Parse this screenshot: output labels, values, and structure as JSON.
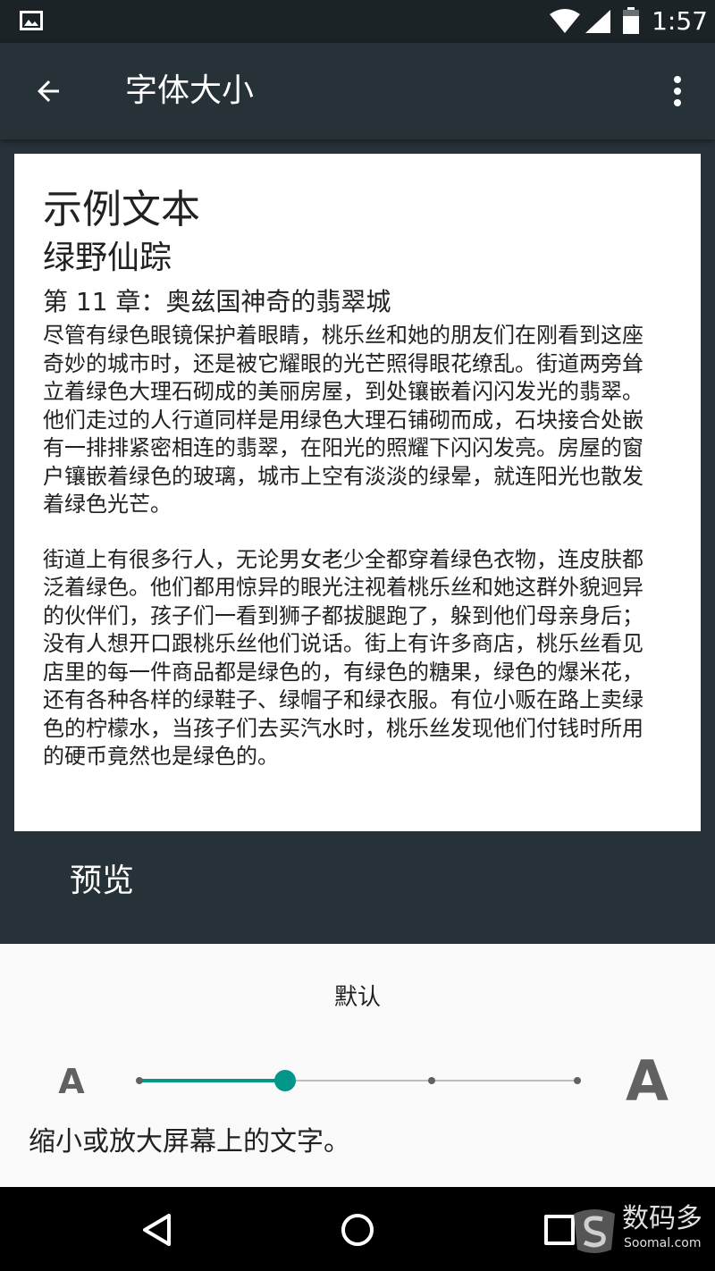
{
  "status_bar": {
    "time": "1:57"
  },
  "app_bar": {
    "title": "字体大小"
  },
  "preview": {
    "heading": "示例文本",
    "book_title": "绿野仙踪",
    "chapter_title": "第 11 章：奥兹国神奇的翡翠城",
    "paragraphs": [
      "尽管有绿色眼镜保护着眼睛，桃乐丝和她的朋友们在刚看到这座奇妙的城市时，还是被它耀眼的光芒照得眼花缭乱。街道两旁耸立着绿色大理石砌成的美丽房屋，到处镶嵌着闪闪发光的翡翠。他们走过的人行道同样是用绿色大理石铺砌而成，石块接合处嵌有一排排紧密相连的翡翠，在阳光的照耀下闪闪发亮。房屋的窗户镶嵌着绿色的玻璃，城市上空有淡淡的绿晕，就连阳光也散发着绿色光芒。",
      "街道上有很多行人，无论男女老少全都穿着绿色衣物，连皮肤都泛着绿色。他们都用惊异的眼光注视着桃乐丝和她这群外貌迥异的伙伴们，孩子们一看到狮子都拔腿跑了，躲到他们母亲身后；没有人想开口跟桃乐丝他们说话。街上有许多商店，桃乐丝看见店里的每一件商品都是绿色的，有绿色的糖果，绿色的爆米花，还有各种各样的绿鞋子、绿帽子和绿衣服。有位小贩在路上卖绿色的柠檬水，当孩子们去买汽水时，桃乐丝发现他们付钱时所用的硬币竟然也是绿色的。"
    ],
    "label": "预览"
  },
  "font_size": {
    "level_name": "默认",
    "small_label": "A",
    "large_label": "A",
    "steps": 4,
    "selected_index": 1,
    "accent_color": "#009688",
    "description": "缩小或放大屏幕上的文字。"
  },
  "watermark": {
    "name": "数码多",
    "domain": "Soomal.com"
  },
  "icons": {
    "status": [
      "gallery-icon",
      "wifi-icon",
      "signal-icon",
      "battery-icon"
    ],
    "app_bar": [
      "arrow-back-icon",
      "more-vert-icon"
    ],
    "navigation": [
      "back-triangle-icon",
      "home-circle-icon",
      "recents-square-icon"
    ]
  }
}
